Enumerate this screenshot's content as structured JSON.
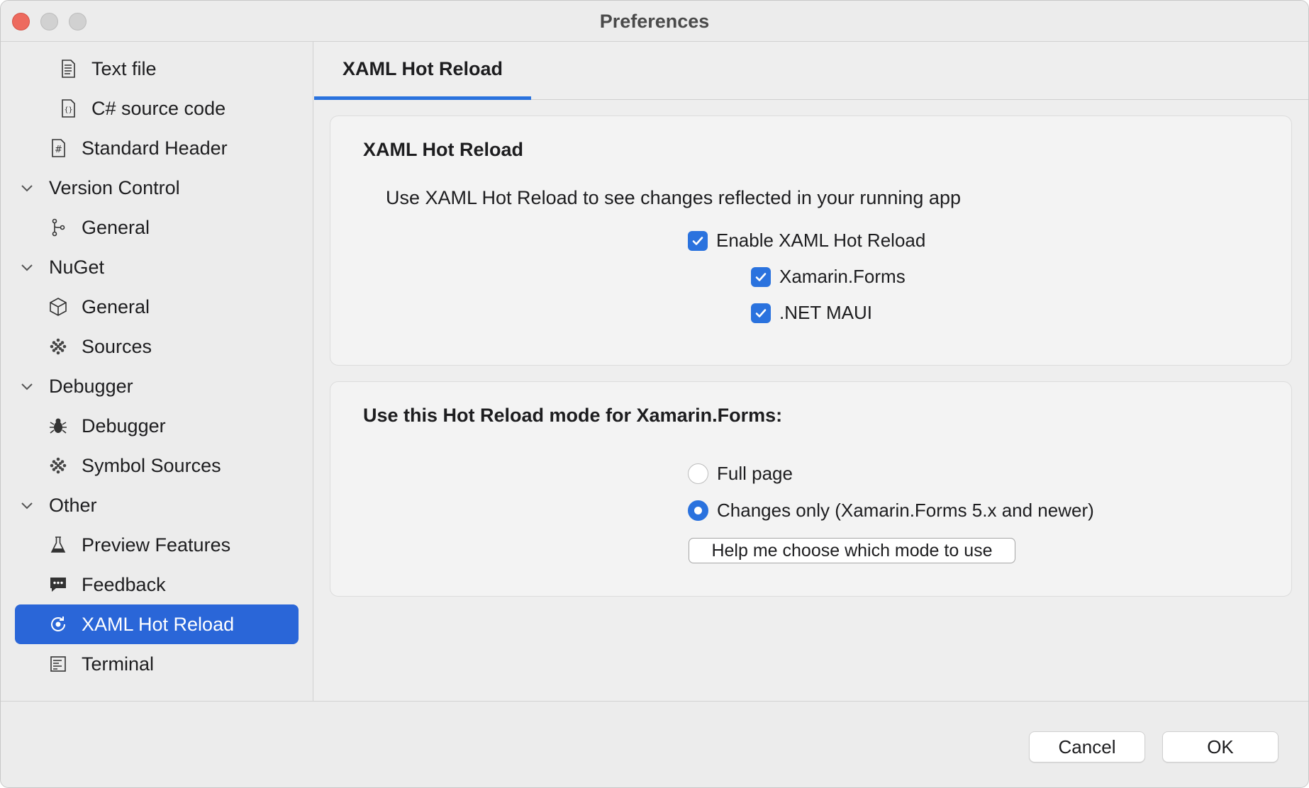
{
  "window": {
    "title": "Preferences"
  },
  "sidebar": {
    "items": [
      {
        "label": "Text file",
        "icon": "text-file-icon"
      },
      {
        "label": "C# source code",
        "icon": "code-file-icon"
      },
      {
        "label": "Standard Header",
        "icon": "hash-file-icon"
      },
      {
        "label": "Version Control",
        "group": true
      },
      {
        "label": "General",
        "icon": "branch-icon"
      },
      {
        "label": "NuGet",
        "group": true
      },
      {
        "label": "General",
        "icon": "package-icon"
      },
      {
        "label": "Sources",
        "icon": "sources-icon"
      },
      {
        "label": "Debugger",
        "group": true
      },
      {
        "label": "Debugger",
        "icon": "bug-icon"
      },
      {
        "label": "Symbol Sources",
        "icon": "sources-icon"
      },
      {
        "label": "Other",
        "group": true
      },
      {
        "label": "Preview Features",
        "icon": "flask-icon"
      },
      {
        "label": "Feedback",
        "icon": "feedback-icon"
      },
      {
        "label": "XAML Hot Reload",
        "icon": "hot-reload-icon",
        "selected": true
      },
      {
        "label": "Terminal",
        "icon": "terminal-icon"
      }
    ]
  },
  "main": {
    "tab": "XAML Hot Reload",
    "section1": {
      "title": "XAML Hot Reload",
      "description": "Use XAML Hot Reload to see changes reflected in your running app",
      "enable_label": "Enable XAML Hot Reload",
      "enable_checked": true,
      "xamarin_label": "Xamarin.Forms",
      "xamarin_checked": true,
      "maui_label": ".NET MAUI",
      "maui_checked": true
    },
    "section2": {
      "title": "Use this Hot Reload mode for Xamarin.Forms:",
      "option_full": "Full page",
      "option_changes": "Changes only (Xamarin.Forms 5.x and newer)",
      "selected_option": "Changes only (Xamarin.Forms 5.x and newer)",
      "help_button": "Help me choose which mode to use"
    }
  },
  "footer": {
    "cancel": "Cancel",
    "ok": "OK"
  },
  "colors": {
    "accent": "#2a72de",
    "selection": "#2a66d8",
    "close": "#ed6a5e"
  }
}
